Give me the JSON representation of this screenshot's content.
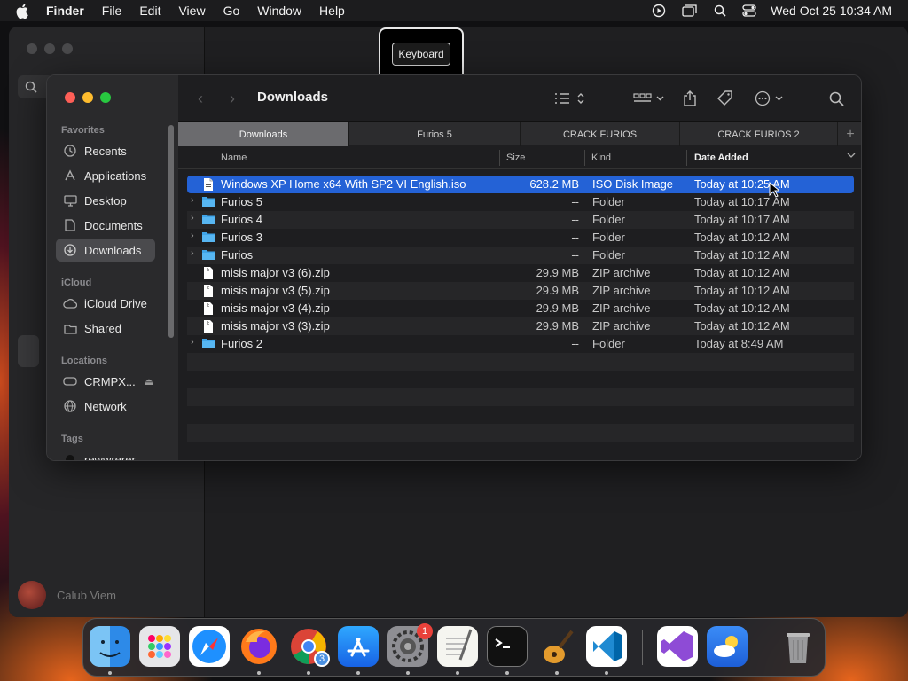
{
  "menubar": {
    "app": "Finder",
    "items": [
      "File",
      "Edit",
      "View",
      "Go",
      "Window",
      "Help"
    ],
    "clock": "Wed Oct 25  10:34 AM"
  },
  "tooltip": {
    "label": "Keyboard"
  },
  "background_window": {
    "profile_name": "Calub Viem"
  },
  "finder": {
    "title": "Downloads",
    "sidebar": {
      "favorites_header": "Favorites",
      "favorites": [
        "Recents",
        "Applications",
        "Desktop",
        "Documents",
        "Downloads"
      ],
      "icloud_header": "iCloud",
      "icloud": [
        "iCloud Drive",
        "Shared"
      ],
      "locations_header": "Locations",
      "locations": [
        "CRMPX...",
        "Network"
      ],
      "tags_header": "Tags",
      "tags": [
        "rewwrerer"
      ]
    },
    "tabs": [
      "Downloads",
      "Furios 5",
      "CRACK FURIOS",
      "CRACK FURIOS 2"
    ],
    "tab_add": "+",
    "columns": {
      "name": "Name",
      "size": "Size",
      "kind": "Kind",
      "date": "Date Added"
    },
    "files": [
      {
        "name": "Windows XP Home x64 With SP2 VI English.iso",
        "size": "628.2 MB",
        "kind": "ISO Disk Image",
        "date": "Today at 10:25 AM"
      },
      {
        "name": "Furios 5",
        "size": "--",
        "kind": "Folder",
        "date": "Today at 10:17 AM"
      },
      {
        "name": "Furios 4",
        "size": "--",
        "kind": "Folder",
        "date": "Today at 10:17 AM"
      },
      {
        "name": "Furios 3",
        "size": "--",
        "kind": "Folder",
        "date": "Today at 10:12 AM"
      },
      {
        "name": "Furios",
        "size": "--",
        "kind": "Folder",
        "date": "Today at 10:12 AM"
      },
      {
        "name": "misis major v3 (6).zip",
        "size": "29.9 MB",
        "kind": "ZIP archive",
        "date": "Today at 10:12 AM"
      },
      {
        "name": "misis major v3 (5).zip",
        "size": "29.9 MB",
        "kind": "ZIP archive",
        "date": "Today at 10:12 AM"
      },
      {
        "name": "misis major v3 (4).zip",
        "size": "29.9 MB",
        "kind": "ZIP archive",
        "date": "Today at 10:12 AM"
      },
      {
        "name": "misis major v3 (3).zip",
        "size": "29.9 MB",
        "kind": "ZIP archive",
        "date": "Today at 10:12 AM"
      },
      {
        "name": "Furios 2",
        "size": "--",
        "kind": "Folder",
        "date": "Today at 8:49 AM"
      }
    ]
  },
  "dock": {
    "chrome_badge": "3",
    "settings_badge": "1"
  }
}
